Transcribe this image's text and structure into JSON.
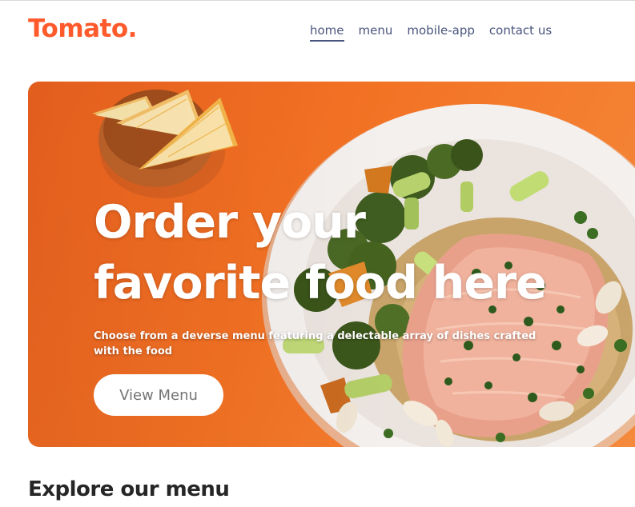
{
  "navbar": {
    "logo": "Tomato.",
    "links": [
      "home",
      "menu",
      "mobile-app",
      "contact us"
    ],
    "active_link": "home"
  },
  "hero": {
    "title": "Order your favorite food here",
    "description": "Choose from a deverse menu featuring a delectable array of dishes crafted with the food",
    "button_label": "View Menu"
  },
  "explore": {
    "heading": "Explore our menu"
  },
  "colors": {
    "brand": "#ff5a2b",
    "nav_text": "#49557e",
    "hero_orange": "#f37224",
    "button_text": "#747474",
    "heading": "#262626"
  }
}
